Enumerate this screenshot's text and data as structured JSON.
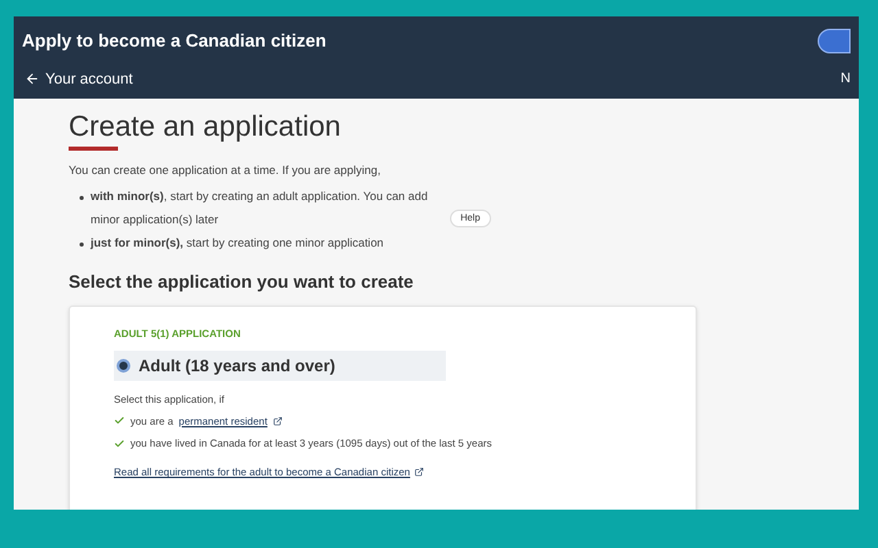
{
  "header": {
    "title": "Apply to become a Canadian citizen",
    "back_link": "Your account",
    "right_text": "N"
  },
  "page": {
    "heading": "Create an application",
    "intro": "You can create one application at a time. If you are applying,",
    "bullets": [
      {
        "text": "**with minor(s)**, start by creating an adult application. You can add minor application(s) later",
        "help": "Help"
      },
      {
        "text": "**just for minor(s),** start by creating one minor application"
      }
    ],
    "section_title": "Select the application you want to create"
  },
  "card": {
    "eyebrow": "ADULT 5(1) APPLICATION",
    "option": {
      "label": "Adult (18 years and over)",
      "selected": true
    },
    "condition_intro": "Select this application, if",
    "conditions": [
      {
        "text": "you are a ",
        "link": "permanent resident"
      },
      {
        "text": "you have lived in Canada for at least 3 years (1095 days) out of the last 5 years"
      }
    ],
    "requirements_link": "Read all requirements for the adult to become a Canadian citizen"
  }
}
